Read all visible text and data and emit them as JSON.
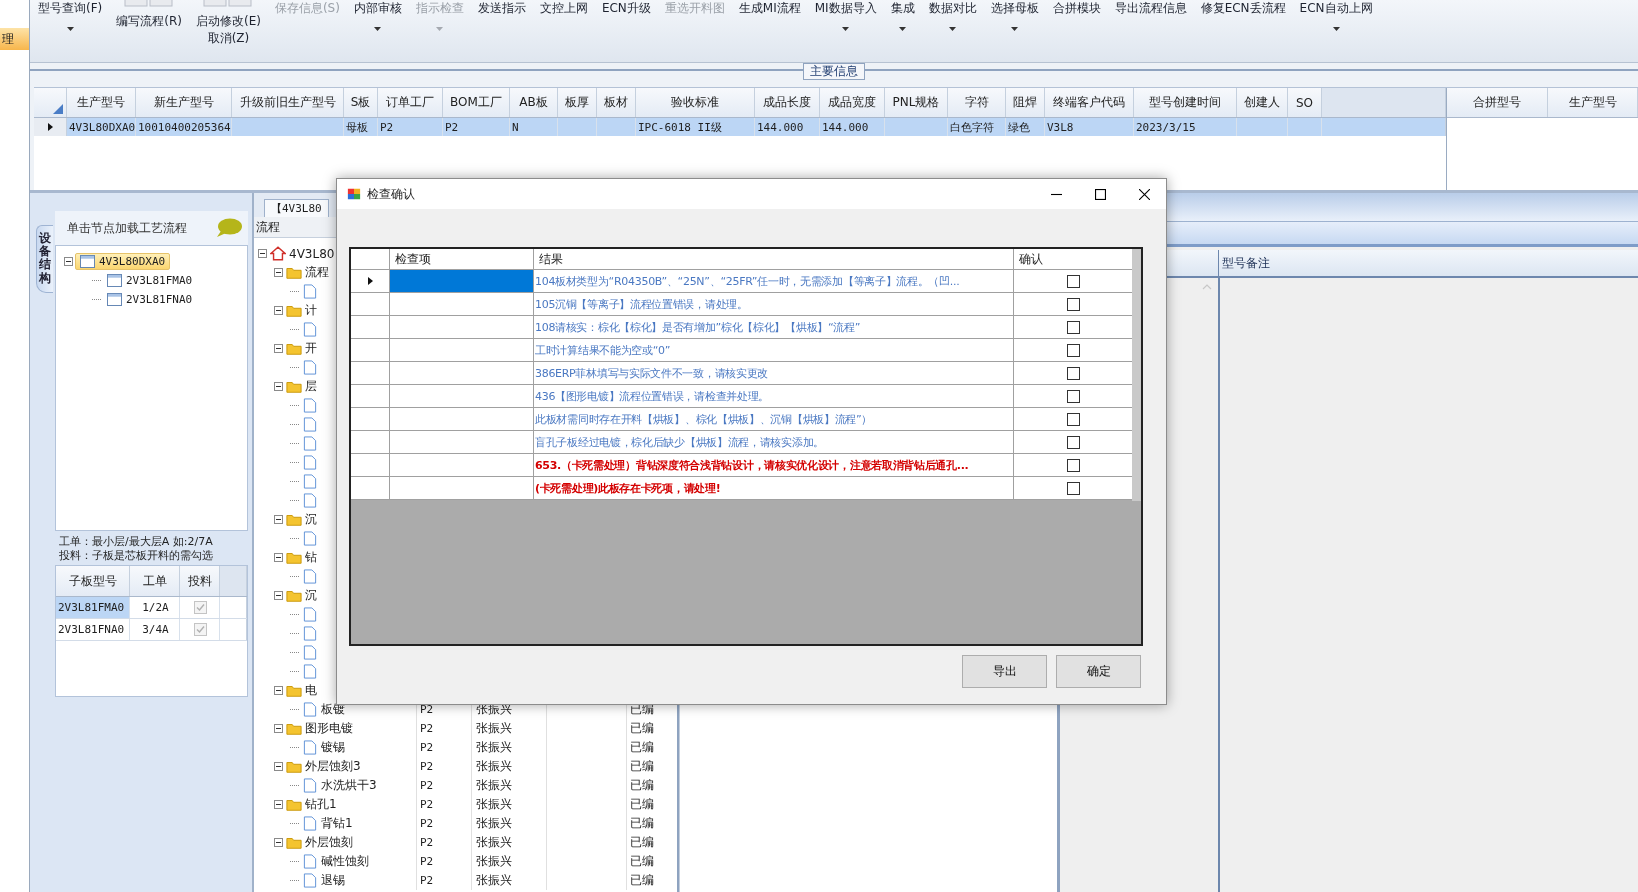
{
  "left_strip": {
    "items": [
      {
        "label": "理",
        "selected": true
      }
    ]
  },
  "toolbar": [
    {
      "label": "型号查询(F)",
      "kind": "large",
      "dropdown": true,
      "disabled": false
    },
    {
      "label": "编写流程(R)",
      "kind": "stacked",
      "dropdown": false,
      "disabled": false
    },
    {
      "label": "启动修改(E)",
      "sublabel": "取消(Z)",
      "kind": "stacked",
      "dropdown": false,
      "disabled": false
    },
    {
      "label": "保存信息(S)",
      "kind": "large",
      "dropdown": false,
      "disabled": true
    },
    {
      "label": "内部审核",
      "kind": "large",
      "dropdown": true,
      "disabled": false
    },
    {
      "label": "指示检查",
      "kind": "large",
      "dropdown": true,
      "disabled": true
    },
    {
      "label": "发送指示",
      "kind": "large",
      "dropdown": false,
      "disabled": false
    },
    {
      "label": "文控上网",
      "kind": "large",
      "dropdown": false,
      "disabled": false
    },
    {
      "label": "ECN升级",
      "kind": "large",
      "dropdown": false,
      "disabled": false
    },
    {
      "label": "重选开料图",
      "kind": "large",
      "dropdown": false,
      "disabled": true
    },
    {
      "label": "生成MI流程",
      "kind": "large",
      "dropdown": false,
      "disabled": false
    },
    {
      "label": "MI数据导入",
      "kind": "large",
      "dropdown": true,
      "disabled": false
    },
    {
      "label": "集成",
      "kind": "large",
      "dropdown": true,
      "disabled": false
    },
    {
      "label": "数据对比",
      "kind": "large",
      "dropdown": true,
      "disabled": false
    },
    {
      "label": "选择母板",
      "kind": "large",
      "dropdown": true,
      "disabled": false
    },
    {
      "label": "合拼模块",
      "kind": "large",
      "dropdown": false,
      "disabled": false
    },
    {
      "label": "导出流程信息",
      "kind": "large",
      "dropdown": false,
      "disabled": false
    },
    {
      "label": "修复ECN丢流程",
      "kind": "large",
      "dropdown": false,
      "disabled": false
    },
    {
      "label": "ECN自动上网",
      "kind": "large",
      "dropdown": true,
      "disabled": false
    }
  ],
  "main_info": {
    "title": "主要信息",
    "table": {
      "columns": [
        "生产型号",
        "新生产型号",
        "升级前旧生产型号",
        "S板",
        "订单工厂",
        "BOM工厂",
        "AB板",
        "板厚",
        "板材",
        "验收标准",
        "成品长度",
        "成品宽度",
        "PNL规格",
        "字符",
        "阻焊",
        "终端客户代码",
        "型号创建时间",
        "创建人",
        "SO"
      ],
      "rows": [
        {
          "selected": true,
          "cells": [
            "4V3L80DXA0",
            "10010400205364",
            "",
            "母板",
            "P2",
            "P2",
            "N",
            "",
            "",
            "IPC-6018 II级",
            "144.000",
            "144.000",
            "",
            "白色字符",
            "绿色",
            "V3L8",
            "2023/3/15",
            "",
            ""
          ]
        }
      ]
    },
    "merge_table": {
      "columns": [
        "合拼型号",
        "生产型号"
      ]
    }
  },
  "structure_panel": {
    "tab": "设备结构",
    "hint": "单击节点加载工艺流程",
    "tree": [
      {
        "label": "4V3L80DXA0",
        "selected": true,
        "expanded": true,
        "children": [
          {
            "label": "2V3L81FMA0",
            "selected": false
          },
          {
            "label": "2V3L81FNA0",
            "selected": false
          }
        ]
      }
    ],
    "note": [
      "工单：最小层/最大层A 如:2/7A",
      "投料：子板是芯板开料的需勾选"
    ],
    "sub_table": {
      "columns": [
        "子板型号",
        "工单",
        "投料"
      ],
      "rows": [
        {
          "cells": [
            "2V3L81FMA0",
            "1/2A"
          ],
          "selected": true,
          "checked": true
        },
        {
          "cells": [
            "2V3L81FNA0",
            "3/4A"
          ],
          "selected": false,
          "checked": true
        }
      ]
    }
  },
  "process_panel": {
    "tab": "【4V3L80",
    "header": "流程",
    "tree": [
      {
        "label": "4V3L80",
        "kind": "root",
        "expanded": true,
        "children": [
          {
            "label": "流程",
            "kind": "folder",
            "expanded": true,
            "children": [
              {
                "kind": "step"
              }
            ]
          },
          {
            "label": "计",
            "kind": "folder",
            "expanded": true,
            "children": [
              {
                "kind": "step"
              }
            ]
          },
          {
            "label": "开",
            "kind": "folder",
            "expanded": true,
            "children": [
              {
                "kind": "step"
              }
            ]
          },
          {
            "label": "层",
            "kind": "folder",
            "expanded": true,
            "children": [
              {
                "kind": "step"
              },
              {
                "kind": "step"
              },
              {
                "kind": "step"
              },
              {
                "kind": "step"
              },
              {
                "kind": "step"
              },
              {
                "kind": "step"
              }
            ]
          },
          {
            "label": "沉",
            "kind": "folder",
            "expanded": true,
            "children": [
              {
                "kind": "step"
              }
            ]
          },
          {
            "label": "钻",
            "kind": "folder",
            "expanded": true,
            "children": [
              {
                "kind": "step"
              }
            ]
          },
          {
            "label": "沉",
            "kind": "folder",
            "expanded": true,
            "children": [
              {
                "kind": "step"
              },
              {
                "kind": "step"
              },
              {
                "kind": "step"
              },
              {
                "kind": "step"
              }
            ]
          },
          {
            "label": "电",
            "kind": "folder",
            "expanded": true,
            "children": [
              {
                "label": "板镀",
                "kind": "step",
                "factory": "P2",
                "owner": "张振兴",
                "status": "已编"
              }
            ]
          },
          {
            "label": "图形电镀",
            "kind": "folder",
            "expanded": true,
            "factory": "P2",
            "owner": "张振兴",
            "status": "已编",
            "children": [
              {
                "label": "镀锡",
                "kind": "step",
                "factory": "P2",
                "owner": "张振兴",
                "status": "已编"
              }
            ]
          },
          {
            "label": "外层蚀刻3",
            "kind": "folder",
            "expanded": true,
            "factory": "P2",
            "owner": "张振兴",
            "status": "已编",
            "children": [
              {
                "label": "水洗烘干3",
                "kind": "step",
                "factory": "P2",
                "owner": "张振兴",
                "status": "已编"
              }
            ]
          },
          {
            "label": "钻孔1",
            "kind": "folder",
            "expanded": true,
            "factory": "P2",
            "owner": "张振兴",
            "status": "已编",
            "children": [
              {
                "label": "背钻1",
                "kind": "step",
                "factory": "P2",
                "owner": "张振兴",
                "status": "已编"
              }
            ]
          },
          {
            "label": "外层蚀刻",
            "kind": "folder",
            "expanded": true,
            "factory": "P2",
            "owner": "张振兴",
            "status": "已编",
            "children": [
              {
                "label": "碱性蚀刻",
                "kind": "step",
                "factory": "P2",
                "owner": "张振兴",
                "status": "已编"
              },
              {
                "label": "退锡",
                "kind": "step",
                "factory": "P2",
                "owner": "张振兴",
                "status": "已编"
              }
            ]
          }
        ]
      }
    ]
  },
  "remarks_panel": {
    "column": "型号备注"
  },
  "dialog": {
    "title": "检查确认",
    "columns": [
      "检查项",
      "结果",
      "确认"
    ],
    "rows": [
      {
        "result": "104板材类型为“R04350B”、“25N”、“25FR”任一时，无需添加【等离子】流程。（凹...",
        "color": "#4a78c2",
        "selected": true,
        "checked": false
      },
      {
        "result": "105沉铜【等离子】流程位置错误，请处理。",
        "color": "#4a78c2",
        "selected": false,
        "checked": false
      },
      {
        "result": "108请核实：棕化【棕化】是否有增加”棕化【棕化】【烘板】“流程”",
        "color": "#4a78c2",
        "selected": false,
        "checked": false
      },
      {
        "result": "工时计算结果不能为空或“0”",
        "color": "#4a78c2",
        "selected": false,
        "checked": false
      },
      {
        "result": "386ERP菲林填写与实际文件不一致，请核实更改",
        "color": "#4a78c2",
        "selected": false,
        "checked": false
      },
      {
        "result": "436【图形电镀】流程位置错误，请检查并处理。",
        "color": "#4a78c2",
        "selected": false,
        "checked": false
      },
      {
        "result": "此板材需同时存在开料【烘板】、棕化【烘板】、沉铜【烘板】流程”）",
        "color": "#4a78c2",
        "selected": false,
        "checked": false
      },
      {
        "result": "盲孔子板经过电镀，棕化后缺少【烘板】流程，请核实添加。",
        "color": "#4a78c2",
        "selected": false,
        "checked": false
      },
      {
        "result": "653.（卡死需处理）背钻深度符合浅背钻设计，请核实优化设计，注意若取消背钻后通孔...",
        "color": "#d40000",
        "selected": false,
        "checked": false
      },
      {
        "result": "(卡死需处理)此板存在卡死项，请处理!",
        "color": "#d40000",
        "selected": false,
        "checked": false
      }
    ],
    "buttons": [
      "导出",
      "确定"
    ]
  }
}
